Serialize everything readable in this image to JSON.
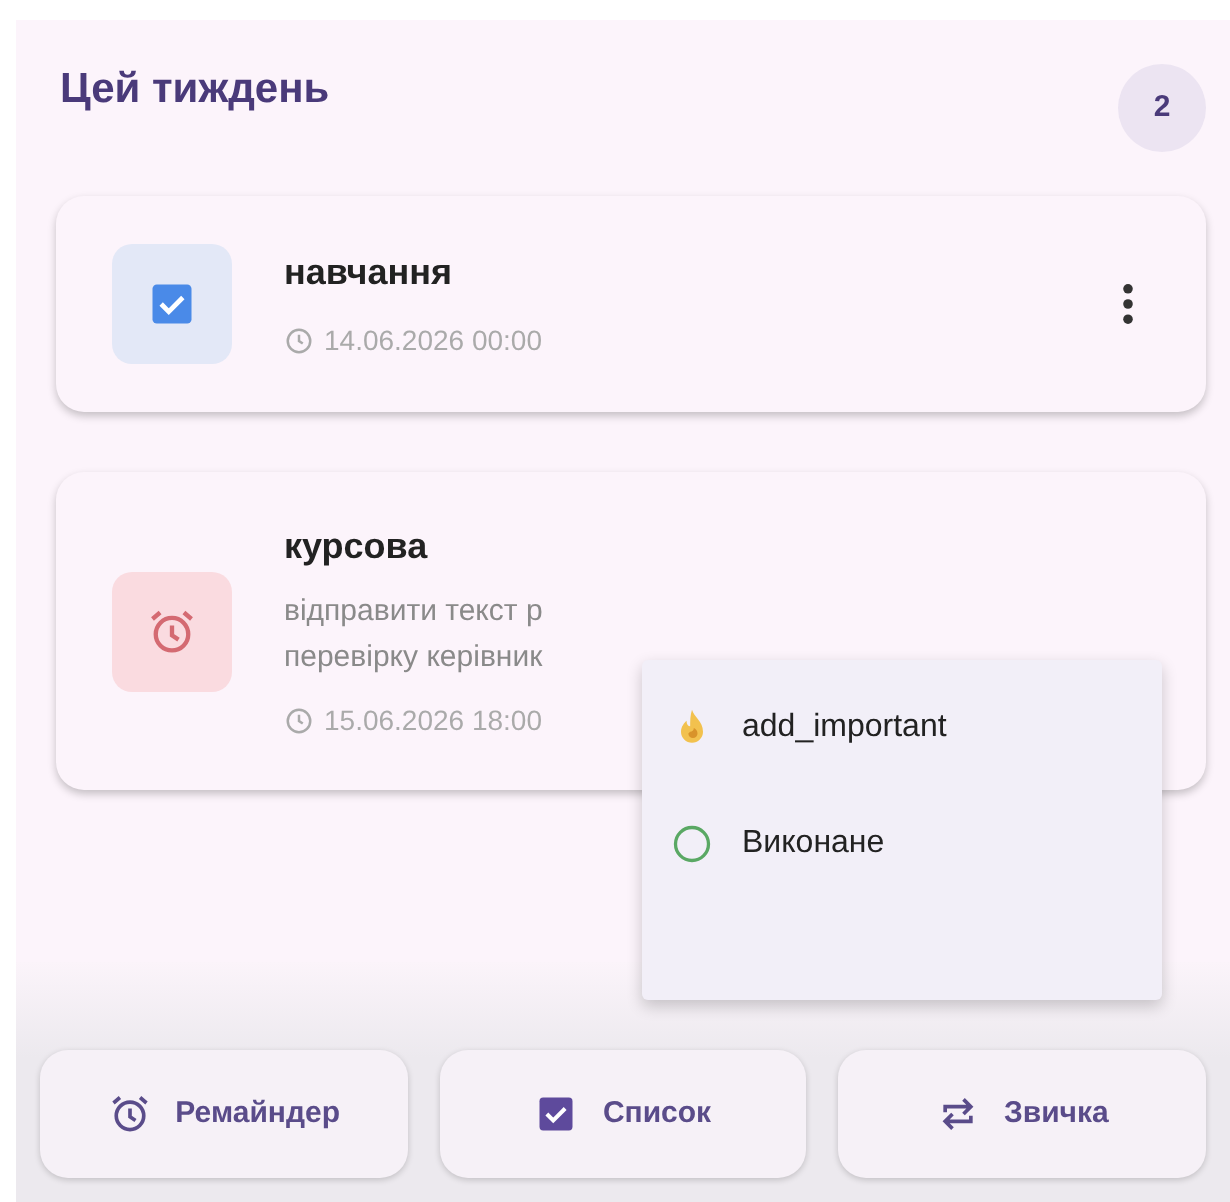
{
  "section": {
    "title": "Цей тиждень",
    "count": "2"
  },
  "tasks": [
    {
      "kind": "list",
      "title": "навчання",
      "time": "14.06.2026 00:00",
      "has_menu": true
    },
    {
      "kind": "reminder",
      "title": "курсова",
      "description": [
        "відправити текст р",
        "перевірку керівник"
      ],
      "time": "15.06.2026 18:00",
      "has_menu": false
    }
  ],
  "menu": {
    "items": [
      {
        "kind": "important",
        "label": "add_important"
      },
      {
        "kind": "done",
        "label": "Виконане"
      }
    ]
  },
  "bottom_buttons": [
    {
      "kind": "reminder",
      "label": "Ремайндер"
    },
    {
      "kind": "list",
      "label": "Список"
    },
    {
      "kind": "habit",
      "label": "Звичка"
    }
  ]
}
